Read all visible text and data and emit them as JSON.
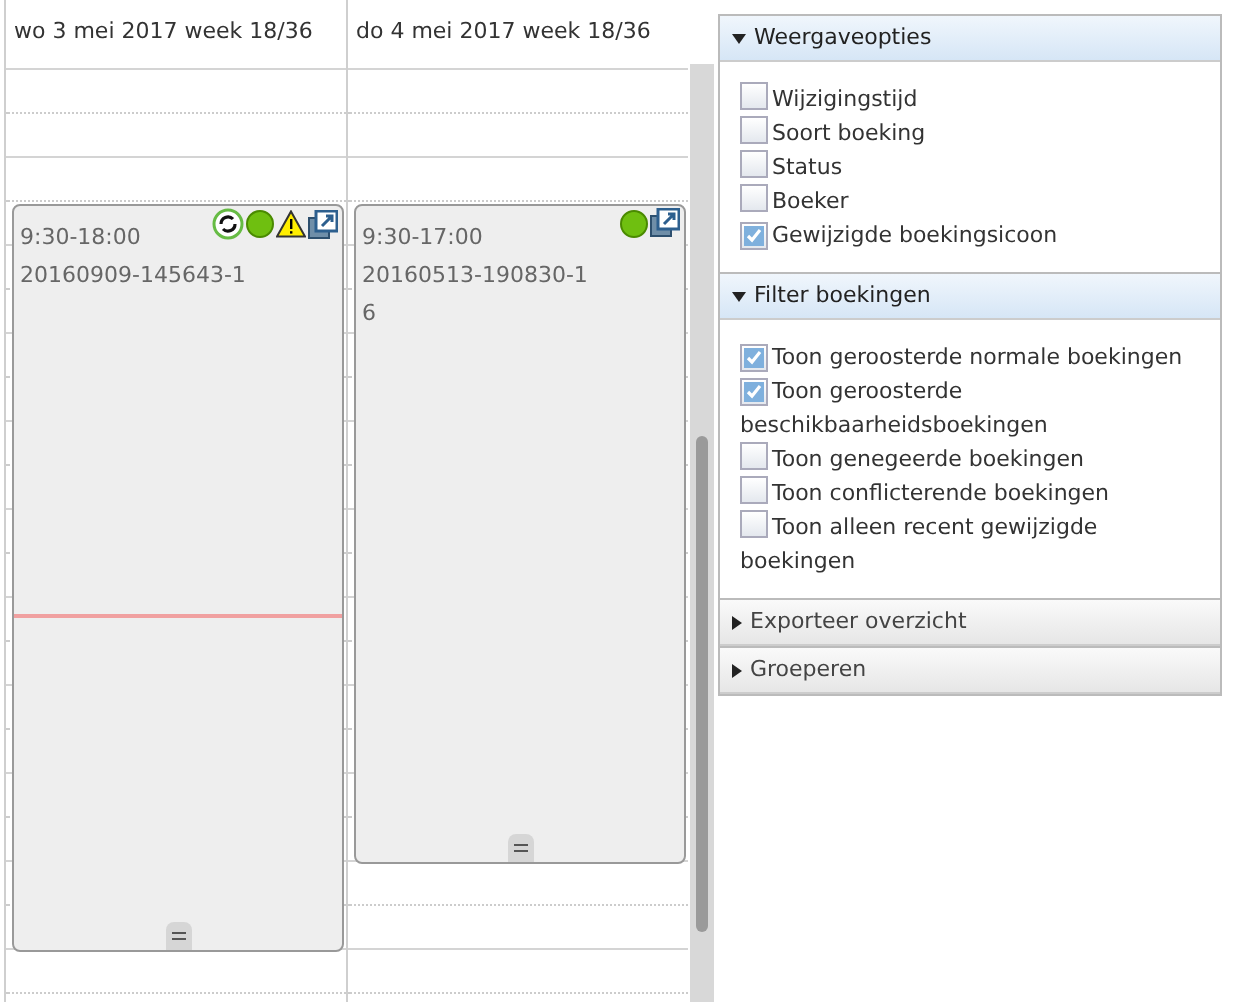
{
  "days": [
    {
      "title": "wo 3 mei 2017 week 18/36",
      "booking": {
        "time": "9:30-18:00",
        "code": "20160909-145643-1",
        "repeat": true,
        "warning": true,
        "kind": "long"
      },
      "now_line": true
    },
    {
      "title": "do 4 mei 2017 week 18/36",
      "booking": {
        "time": "9:30-17:00",
        "code": "20160513-190830-1\n6",
        "repeat": false,
        "warning": false,
        "kind": "short"
      },
      "now_line": false
    }
  ],
  "sections": [
    {
      "title": "Weergaveopties",
      "expanded": true,
      "options": [
        {
          "label": "Wijzigingstijd",
          "checked": false
        },
        {
          "label": "Soort boeking",
          "checked": false
        },
        {
          "label": "Status",
          "checked": false
        },
        {
          "label": "Boeker",
          "checked": false
        },
        {
          "label": "Gewijzigde boekingsicoon",
          "checked": true
        }
      ]
    },
    {
      "title": "Filter boekingen",
      "expanded": true,
      "options": [
        {
          "label": "Toon geroosterde normale boekingen",
          "checked": true
        },
        {
          "label": "Toon geroosterde beschikbaarheidsboekingen",
          "checked": true
        },
        {
          "label": "Toon genegeerde boekingen",
          "checked": false
        },
        {
          "label": "Toon conflicterende boekingen",
          "checked": false
        },
        {
          "label": "Toon alleen recent gewijzigde boekingen",
          "checked": false
        }
      ]
    },
    {
      "title": "Exporteer overzicht",
      "expanded": false
    },
    {
      "title": "Groeperen",
      "expanded": false
    }
  ]
}
